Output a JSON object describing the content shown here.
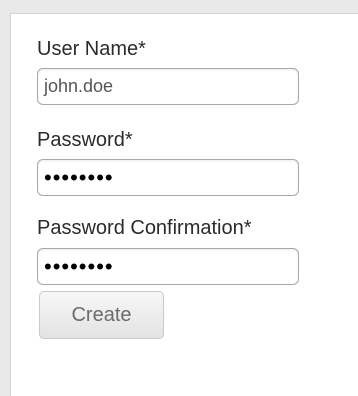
{
  "form": {
    "username": {
      "label": "User Name*",
      "value": "john.doe"
    },
    "password": {
      "label": "Password*",
      "value": "••••••••"
    },
    "password_confirmation": {
      "label": "Password Confirmation*",
      "value": "••••••••"
    },
    "submit_label": "Create"
  }
}
